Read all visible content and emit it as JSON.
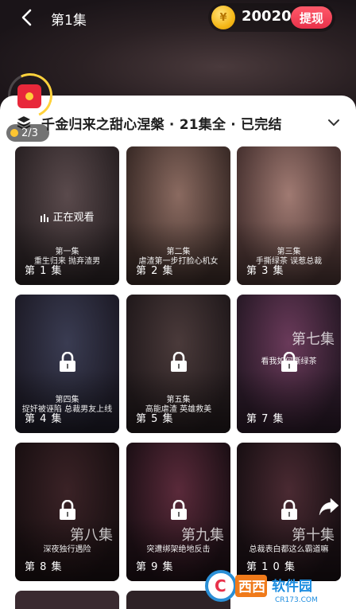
{
  "header": {
    "episode_title": "第1集",
    "coin_symbol": "¥",
    "coin_count": "20020",
    "withdraw_label": "提现"
  },
  "reward": {
    "progress_text": "2/3",
    "progress_fraction": 0.67
  },
  "series": {
    "title": "千金归来之甜心涅槃 · 21集全 · 已完结"
  },
  "episodes": [
    {
      "label": "第 1 集",
      "subtitle": [
        "第一集",
        "重生归来 抛弃渣男"
      ],
      "locked": false,
      "watching_text": "正在观看",
      "big_title": ""
    },
    {
      "label": "第 2 集",
      "subtitle": [
        "第二集",
        "虐渣第一步打脸心机女"
      ],
      "locked": false,
      "watching_text": "",
      "big_title": ""
    },
    {
      "label": "第 3 集",
      "subtitle": [
        "第三集",
        "手撕绿茶 误惹总裁"
      ],
      "locked": false,
      "watching_text": "",
      "big_title": ""
    },
    {
      "label": "第 4 集",
      "subtitle": [
        "第四集",
        "捉奸被诬陷 总裁男友上线"
      ],
      "locked": true,
      "watching_text": "",
      "big_title": ""
    },
    {
      "label": "第 5 集",
      "subtitle": [
        "第五集",
        "高能虐渣 英雄救美"
      ],
      "locked": true,
      "watching_text": "",
      "big_title": ""
    },
    {
      "label": "第 7 集",
      "subtitle": [
        "看我如何撕绿茶"
      ],
      "locked": true,
      "watching_text": "",
      "big_title": "第七集"
    },
    {
      "label": "第 8 集",
      "subtitle": [
        "深夜独行遇险"
      ],
      "locked": true,
      "watching_text": "",
      "big_title": "第八集"
    },
    {
      "label": "第 9 集",
      "subtitle": [
        "突遭绑架绝地反击"
      ],
      "locked": true,
      "watching_text": "",
      "big_title": "第九集"
    },
    {
      "label": "第 1 0 集",
      "subtitle": [
        "总裁表白都这么霸道嘛"
      ],
      "locked": true,
      "watching_text": "",
      "big_title": "第十集"
    }
  ],
  "watermark": {
    "brand": "西西软件园",
    "domain": "CR173.COM"
  },
  "colors": {
    "accent_red": "#e8314a",
    "coin_gold": "#f5b819",
    "sheet_bg": "#ffffff"
  }
}
